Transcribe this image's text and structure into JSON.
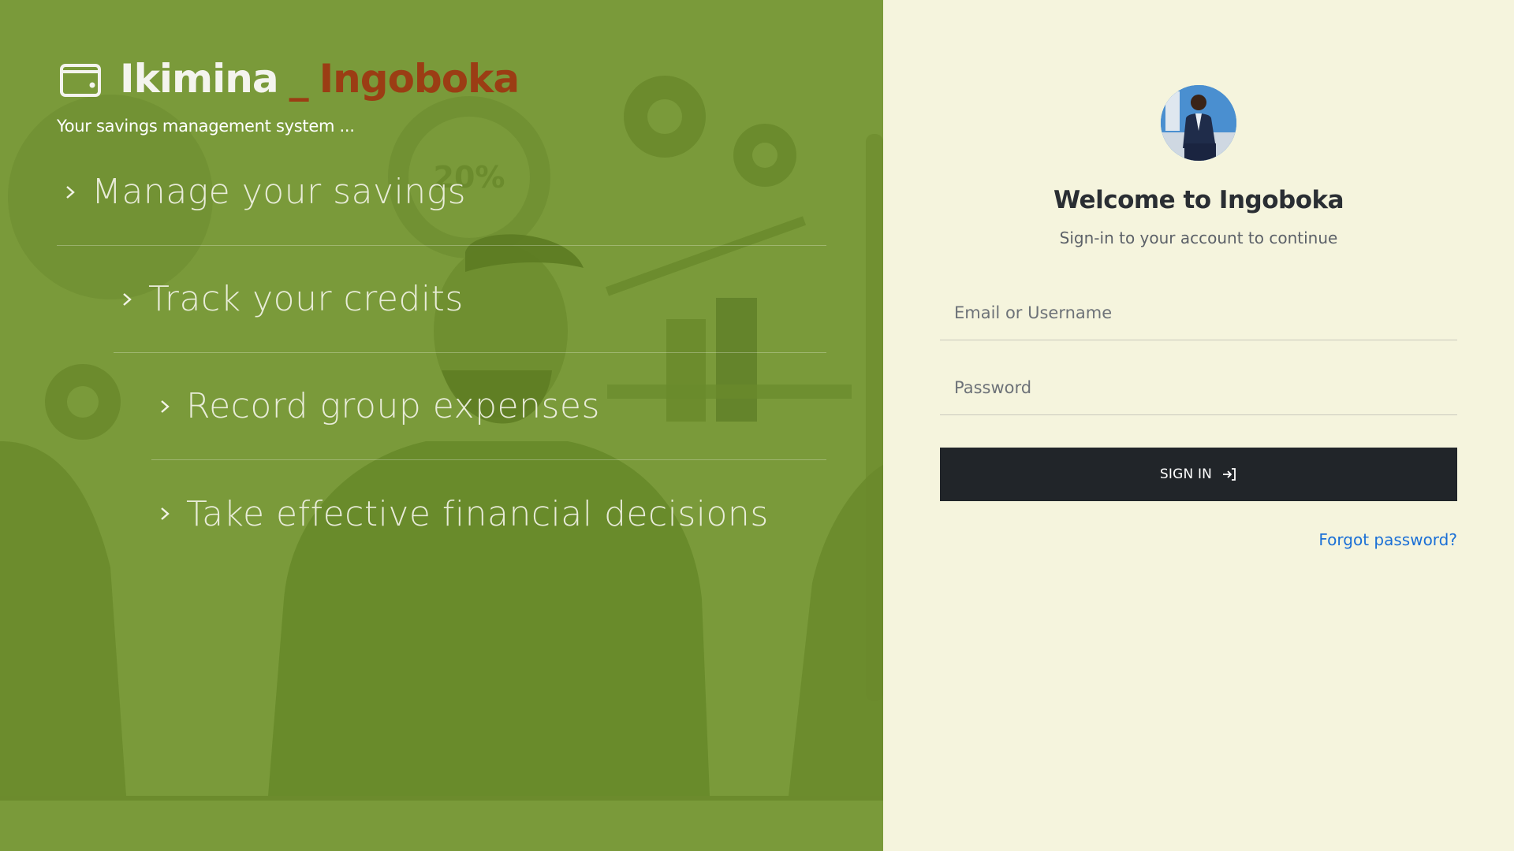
{
  "brand": {
    "name_primary": "Ikimina",
    "separator": "_",
    "name_secondary": "Ingoboka",
    "tagline": "Your savings management system ...",
    "icon": "wallet-icon"
  },
  "illustration": {
    "percent_label": "20%"
  },
  "features": [
    {
      "label": "Manage your savings",
      "icon": "chevron-right-icon"
    },
    {
      "label": "Track your credits",
      "icon": "chevron-right-icon"
    },
    {
      "label": "Record group expenses",
      "icon": "chevron-right-icon"
    },
    {
      "label": "Take effective financial decisions",
      "icon": "chevron-right-icon"
    }
  ],
  "login": {
    "title": "Welcome to Ingoboka",
    "subtitle": "Sign-in to your account to continue",
    "username": {
      "value": "",
      "placeholder": "Email or Username"
    },
    "password": {
      "value": "",
      "placeholder": "Password"
    },
    "submit_label": "SIGN IN",
    "submit_icon": "sign-in-icon",
    "forgot_label": "Forgot password?"
  },
  "colors": {
    "left_panel": "#7a9a3a",
    "right_panel": "#f5f4dd",
    "brand_accent": "#9b3d14",
    "button": "#212529",
    "link": "#1a6fd6"
  }
}
